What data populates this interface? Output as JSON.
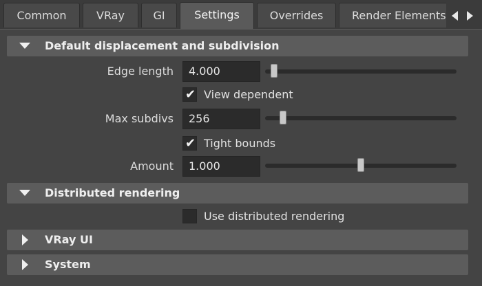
{
  "tabs": [
    {
      "label": "Common",
      "active": false
    },
    {
      "label": "VRay",
      "active": false
    },
    {
      "label": "GI",
      "active": false
    },
    {
      "label": "Settings",
      "active": true
    },
    {
      "label": "Overrides",
      "active": false
    },
    {
      "label": "Render Elements",
      "active": false
    }
  ],
  "tab_scroll": {
    "left_icon": "scroll-left-icon",
    "right_icon": "scroll-right-icon"
  },
  "sections": {
    "displacement": {
      "title": "Default displacement and subdivision",
      "expanded": true,
      "edge_length": {
        "label": "Edge length",
        "value": "4.000",
        "slider_fraction": 0.03
      },
      "view_dependent": {
        "label": "View dependent",
        "checked": true
      },
      "max_subdivs": {
        "label": "Max subdivs",
        "value": "256",
        "slider_fraction": 0.08
      },
      "tight_bounds": {
        "label": "Tight bounds",
        "checked": true
      },
      "amount": {
        "label": "Amount",
        "value": "1.000",
        "slider_fraction": 0.5
      }
    },
    "distributed": {
      "title": "Distributed rendering",
      "expanded": true,
      "use_distributed": {
        "label": "Use distributed rendering",
        "checked": false
      }
    },
    "vray_ui": {
      "title": "VRay UI",
      "expanded": false
    },
    "system": {
      "title": "System",
      "expanded": false
    }
  },
  "colors": {
    "background": "#444444",
    "section_header": "#5c5c5c",
    "field": "#2b2b2b",
    "text": "#e6e6e6"
  }
}
